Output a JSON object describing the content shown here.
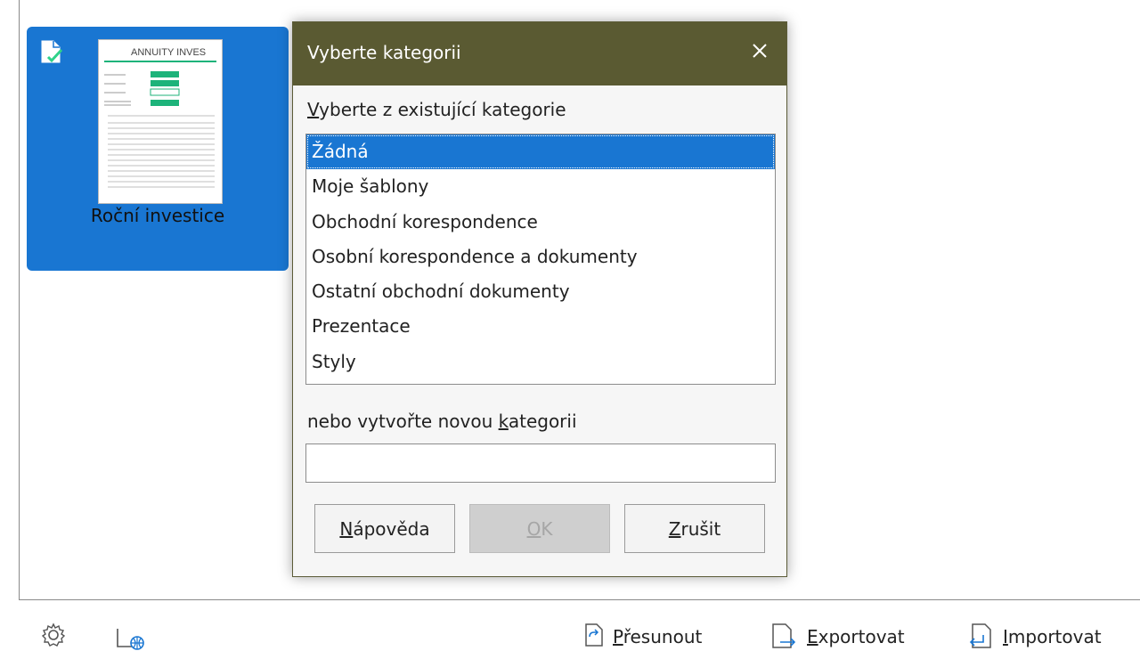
{
  "template_tile": {
    "name": "Roční investice",
    "thumbnail_title": "ANNUITY INVES"
  },
  "dialog": {
    "title": "Vyberte kategorii",
    "existing_label_mnemonic": "V",
    "existing_label_rest": "yberte z existující kategorie",
    "categories": [
      "Žádná",
      "Moje šablony",
      "Obchodní korespondence",
      "Osobní korespondence a dokumenty",
      "Ostatní obchodní dokumenty",
      "Prezentace",
      "Styly"
    ],
    "selected_category": "Žádná",
    "new_label_pre": "nebo vytvořte novou ",
    "new_label_mnemonic": "k",
    "new_label_post": "ategorii",
    "new_category_value": "",
    "buttons": {
      "help_mnemonic": "N",
      "help_rest": "ápověda",
      "ok_mnemonic": "O",
      "ok_rest": "K",
      "cancel_mnemonic": "Z",
      "cancel_rest": "rušit"
    }
  },
  "toolbar": {
    "move_mnemonic": "P",
    "move_rest": "řesunout",
    "export_mnemonic": "E",
    "export_rest": "xportovat",
    "import_mnemonic": "I",
    "import_rest": "mportovat"
  },
  "colors": {
    "selection": "#1976d2",
    "dialog_title_bar": "#5a5a32",
    "thumbnail_accent": "#1db37a"
  }
}
